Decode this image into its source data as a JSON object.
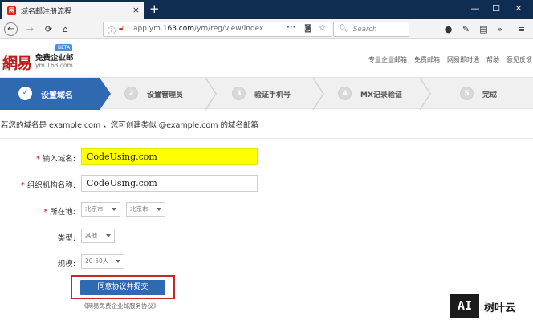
{
  "browser": {
    "tab_title": "域名邮注册流程",
    "tab_favicon": "网",
    "tab_close": "×",
    "new_tab": "+",
    "win_minimize": "—",
    "win_maximize": "☐",
    "win_close": "✕",
    "url_prefix": "app.ym.",
    "url_domain": "163.com",
    "url_path": "/ym/reg/view/index",
    "url_more": "···",
    "search_placeholder": "Search"
  },
  "site": {
    "logo": "網易",
    "logo_subtitle": "免费企业邮",
    "logo_domain": "ym.163.com",
    "beta": "BETA",
    "top_links": [
      "专业企业邮箱",
      "免费邮箱",
      "网易即时通",
      "帮助",
      "意见反馈"
    ]
  },
  "steps": [
    {
      "num": "✓",
      "label": "设置域名",
      "active": true
    },
    {
      "num": "2",
      "label": "设置管理员",
      "active": false
    },
    {
      "num": "3",
      "label": "验证手机号",
      "active": false
    },
    {
      "num": "4",
      "label": "MX记录验证",
      "active": false
    },
    {
      "num": "5",
      "label": "完成",
      "active": false
    }
  ],
  "form": {
    "intro": "若您的域名是 example.com ，您可创建类似 @example.com 的域名邮箱",
    "domain_label": "输入域名:",
    "domain_value": "CodeUsing.com",
    "org_label": "组织机构名称:",
    "org_value": "CodeUsing.com",
    "location_label": "所在地:",
    "province": "北京市",
    "city": "北京市",
    "type_label": "类型:",
    "type_value": "其他",
    "scale_label": "规模:",
    "scale_value": "20-50人",
    "required_mark": "*",
    "submit": "同意协议并提交",
    "agreement": "《网易免费企业邮服务协议》"
  },
  "watermark": {
    "logo": "AI",
    "text": "树叶云"
  },
  "colors": {
    "titlebar": "#0f2c52",
    "step_active": "#2e69b1",
    "logo_red": "#c01a1a",
    "highlight": "#ffff00",
    "submit_border": "#c62828"
  }
}
